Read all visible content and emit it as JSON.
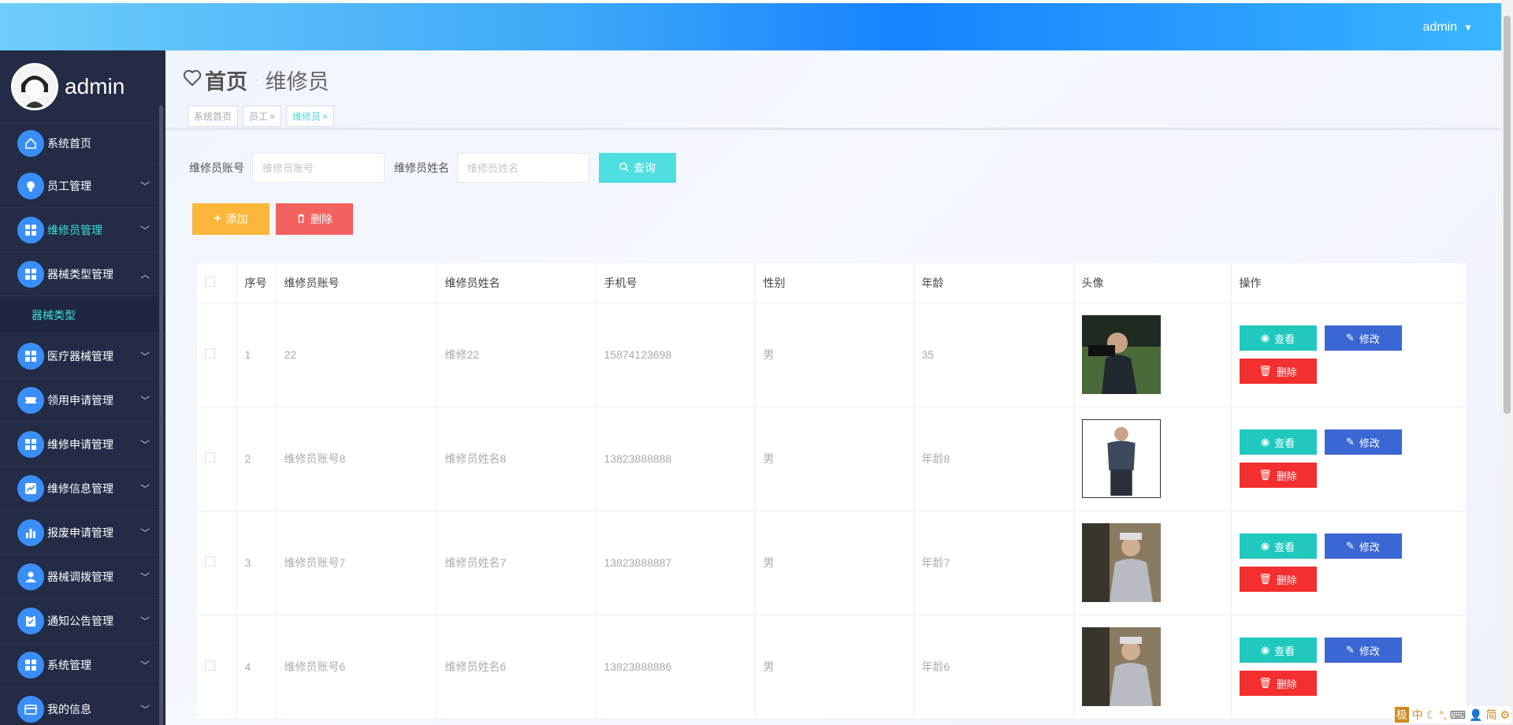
{
  "header": {
    "user": "admin"
  },
  "sidebar": {
    "brand": "admin",
    "items": [
      {
        "label": "系统首页",
        "icon": "home-icon",
        "expandable": false
      },
      {
        "label": "员工管理",
        "icon": "bulb-icon",
        "expandable": true
      },
      {
        "label": "维修员管理",
        "icon": "grid-icon",
        "expandable": true,
        "active": true
      },
      {
        "label": "器械类型管理",
        "icon": "grid-icon",
        "expandable": true,
        "open": true
      },
      {
        "label": "医疗器械管理",
        "icon": "grid-icon",
        "expandable": true
      },
      {
        "label": "领用申请管理",
        "icon": "ticket-icon",
        "expandable": true
      },
      {
        "label": "维修申请管理",
        "icon": "grid-icon",
        "expandable": true
      },
      {
        "label": "维修信息管理",
        "icon": "chart-icon",
        "expandable": true
      },
      {
        "label": "报废申请管理",
        "icon": "bar-chart-icon",
        "expandable": true
      },
      {
        "label": "器械调拨管理",
        "icon": "user-icon",
        "expandable": true
      },
      {
        "label": "通知公告管理",
        "icon": "clipboard-icon",
        "expandable": true
      },
      {
        "label": "系统管理",
        "icon": "grid-icon",
        "expandable": true
      },
      {
        "label": "我的信息",
        "icon": "card-icon",
        "expandable": true
      }
    ],
    "submenu": {
      "label": "器械类型"
    }
  },
  "page": {
    "home": "首页",
    "current": "维修员",
    "tags": [
      "系统首页",
      "员工",
      "维修员"
    ]
  },
  "search": {
    "account_label": "维修员账号",
    "account_placeholder": "维修员账号",
    "name_label": "维修员姓名",
    "name_placeholder": "维修员姓名",
    "query": "查询"
  },
  "actions": {
    "add": "添加",
    "delete": "删除"
  },
  "table": {
    "headers": [
      "序号",
      "维修员账号",
      "维修员姓名",
      "手机号",
      "性别",
      "年龄",
      "头像",
      "操作"
    ],
    "ops": {
      "view": "查看",
      "edit": "修改",
      "delete": "删除"
    },
    "rows": [
      {
        "no": "1",
        "account": "22",
        "name": "维修22",
        "phone": "15874123698",
        "gender": "男",
        "age": "35"
      },
      {
        "no": "2",
        "account": "维修员账号8",
        "name": "维修员姓名8",
        "phone": "13823888888",
        "gender": "男",
        "age": "年龄8"
      },
      {
        "no": "3",
        "account": "维修员账号7",
        "name": "维修员姓名7",
        "phone": "13823888887",
        "gender": "男",
        "age": "年龄7"
      },
      {
        "no": "4",
        "account": "维修员账号6",
        "name": "维修员姓名6",
        "phone": "13823888886",
        "gender": "男",
        "age": "年龄6"
      }
    ]
  },
  "tray": [
    "极",
    "中",
    "简"
  ],
  "colors": {
    "accent": "#3ee0d8",
    "sidebar": "#232b45",
    "header": "#1683ff"
  }
}
